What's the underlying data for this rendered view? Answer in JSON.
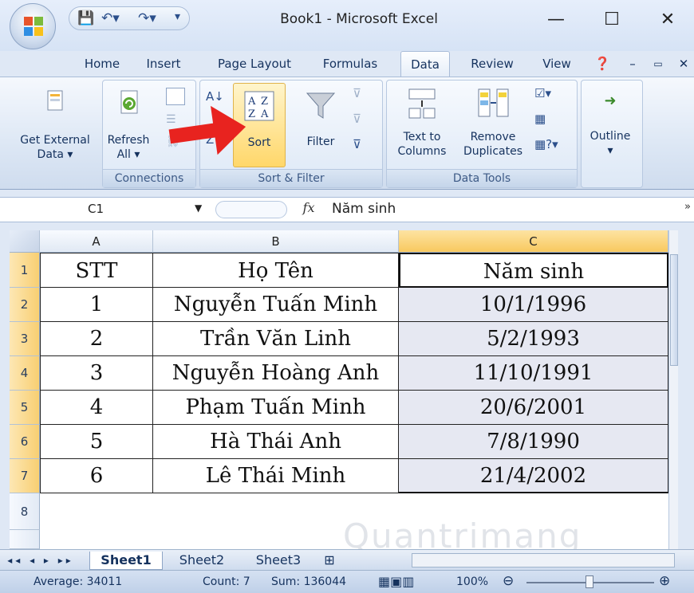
{
  "window": {
    "title": "Book1 - Microsoft Excel",
    "minimize": "—",
    "maximize": "☐",
    "close": "✕"
  },
  "tabs": [
    "Home",
    "Insert",
    "Page Layout",
    "Formulas",
    "Data",
    "Review",
    "View"
  ],
  "ribbon": {
    "groups": {
      "connections": "Connections",
      "sort_filter": "Sort & Filter",
      "data_tools": "Data Tools"
    },
    "get_external": [
      "Get External",
      "Data ▾"
    ],
    "refresh": [
      "Refresh",
      "All ▾"
    ],
    "sort": "Sort",
    "filter": "Filter",
    "text_to_columns": [
      "Text to",
      "Columns"
    ],
    "remove_duplicates": [
      "Remove",
      "Duplicates"
    ],
    "outline": "Outline",
    "outline_arrow": "▾"
  },
  "formula_bar": {
    "name_box": "C1",
    "fx": "fx",
    "value": "Năm sinh"
  },
  "columns": [
    "A",
    "B",
    "C"
  ],
  "rows": [
    {
      "num": "1",
      "a": "STT",
      "b": "Họ Tên",
      "c": "Năm sinh"
    },
    {
      "num": "2",
      "a": "1",
      "b": "Nguyễn Tuấn Minh",
      "c": "10/1/1996"
    },
    {
      "num": "3",
      "a": "2",
      "b": "Trần Văn Linh",
      "c": "5/2/1993"
    },
    {
      "num": "4",
      "a": "3",
      "b": "Nguyễn Hoàng Anh",
      "c": "11/10/1991"
    },
    {
      "num": "5",
      "a": "4",
      "b": "Phạm Tuấn Minh",
      "c": "20/6/2001"
    },
    {
      "num": "6",
      "a": "5",
      "b": "Hà Thái Anh",
      "c": "7/8/1990"
    },
    {
      "num": "7",
      "a": "6",
      "b": "Lê Thái Minh",
      "c": "21/4/2002"
    },
    {
      "num": "8",
      "a": "",
      "b": "",
      "c": ""
    }
  ],
  "sheets": [
    "Sheet1",
    "Sheet2",
    "Sheet3"
  ],
  "status": {
    "average": "Average: 34011",
    "count": "Count: 7",
    "sum": "Sum: 136044",
    "zoom": "100%"
  },
  "watermark": "Quantrimang",
  "colors": {
    "accent_arrow": "#e8231f",
    "selected_header": "#f8c95f",
    "ribbon_bg": "#dbe6f4"
  }
}
